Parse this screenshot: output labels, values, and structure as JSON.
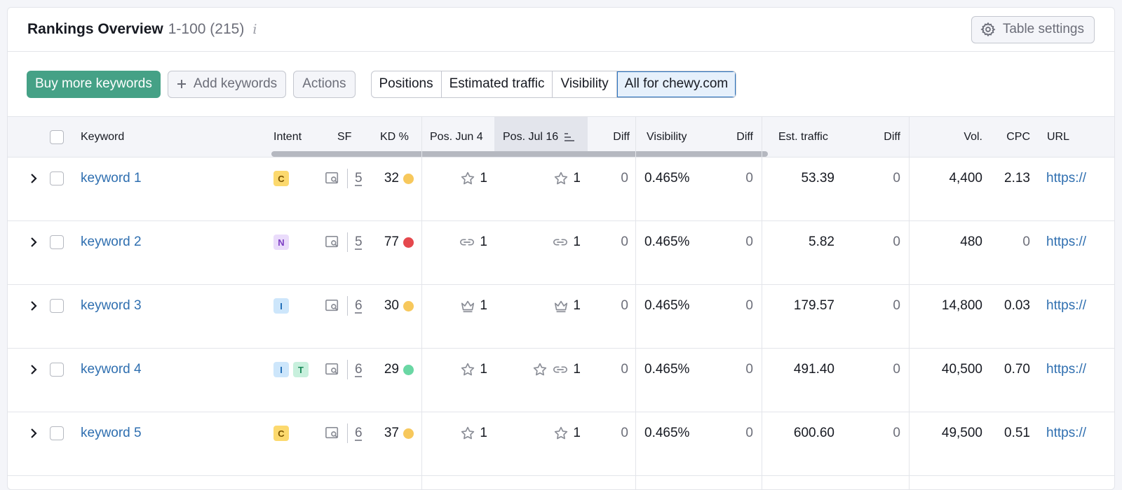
{
  "header": {
    "title": "Rankings Overview",
    "range": "1-100 (215)",
    "info_icon": "i",
    "settings_label": "Table settings"
  },
  "toolbar": {
    "buy_label": "Buy more keywords",
    "add_label": "Add keywords",
    "actions_label": "Actions",
    "views": [
      "Positions",
      "Estimated traffic",
      "Visibility",
      "All for chewy.com"
    ],
    "active_view": "All for chewy.com"
  },
  "columns": {
    "keyword": "Keyword",
    "intent": "Intent",
    "sf": "SF",
    "kd": "KD %",
    "pos_jun": "Pos. Jun 4",
    "pos_jul": "Pos. Jul 16",
    "pos_diff": "Diff",
    "visibility": "Visibility",
    "vis_diff": "Diff",
    "traffic": "Est. traffic",
    "traffic_diff": "Diff",
    "vol": "Vol.",
    "cpc": "CPC",
    "url": "URL"
  },
  "rows": [
    {
      "keyword": "keyword 1",
      "intents": [
        "C"
      ],
      "sf": "5",
      "kd": "32",
      "kd_color": "#f7c85c",
      "pos_jun_icon": "star-icon",
      "pos_jun": "1",
      "pos_jul_icons": [
        "star-icon"
      ],
      "pos_jul": "1",
      "pos_diff": "0",
      "visibility": "0.465%",
      "vis_diff": "0",
      "traffic": "53.39",
      "traffic_diff": "0",
      "vol": "4,400",
      "cpc": "2.13",
      "url": "https://"
    },
    {
      "keyword": "keyword 2",
      "intents": [
        "N"
      ],
      "sf": "5",
      "kd": "77",
      "kd_color": "#e5484d",
      "pos_jun_icon": "link-icon",
      "pos_jun": "1",
      "pos_jul_icons": [
        "link-icon"
      ],
      "pos_jul": "1",
      "pos_diff": "0",
      "visibility": "0.465%",
      "vis_diff": "0",
      "traffic": "5.82",
      "traffic_diff": "0",
      "vol": "480",
      "cpc": "0",
      "url": "https://"
    },
    {
      "keyword": "keyword 3",
      "intents": [
        "I"
      ],
      "sf": "6",
      "kd": "30",
      "kd_color": "#f7c85c",
      "pos_jun_icon": "crown-icon",
      "pos_jun": "1",
      "pos_jul_icons": [
        "crown-icon"
      ],
      "pos_jul": "1",
      "pos_diff": "0",
      "visibility": "0.465%",
      "vis_diff": "0",
      "traffic": "179.57",
      "traffic_diff": "0",
      "vol": "14,800",
      "cpc": "0.03",
      "url": "https://"
    },
    {
      "keyword": "keyword 4",
      "intents": [
        "I",
        "T"
      ],
      "sf": "6",
      "kd": "29",
      "kd_color": "#6ad7a4",
      "pos_jun_icon": "star-icon",
      "pos_jun": "1",
      "pos_jul_icons": [
        "star-icon",
        "link-icon"
      ],
      "pos_jul": "1",
      "pos_diff": "0",
      "visibility": "0.465%",
      "vis_diff": "0",
      "traffic": "491.40",
      "traffic_diff": "0",
      "vol": "40,500",
      "cpc": "0.70",
      "url": "https://"
    },
    {
      "keyword": "keyword 5",
      "intents": [
        "C"
      ],
      "sf": "6",
      "kd": "37",
      "kd_color": "#f7c85c",
      "pos_jun_icon": "star-icon",
      "pos_jun": "1",
      "pos_jul_icons": [
        "star-icon"
      ],
      "pos_jul": "1",
      "pos_diff": "0",
      "visibility": "0.465%",
      "vis_diff": "0",
      "traffic": "600.60",
      "traffic_diff": "0",
      "vol": "49,500",
      "cpc": "0.51",
      "url": "https://"
    }
  ]
}
